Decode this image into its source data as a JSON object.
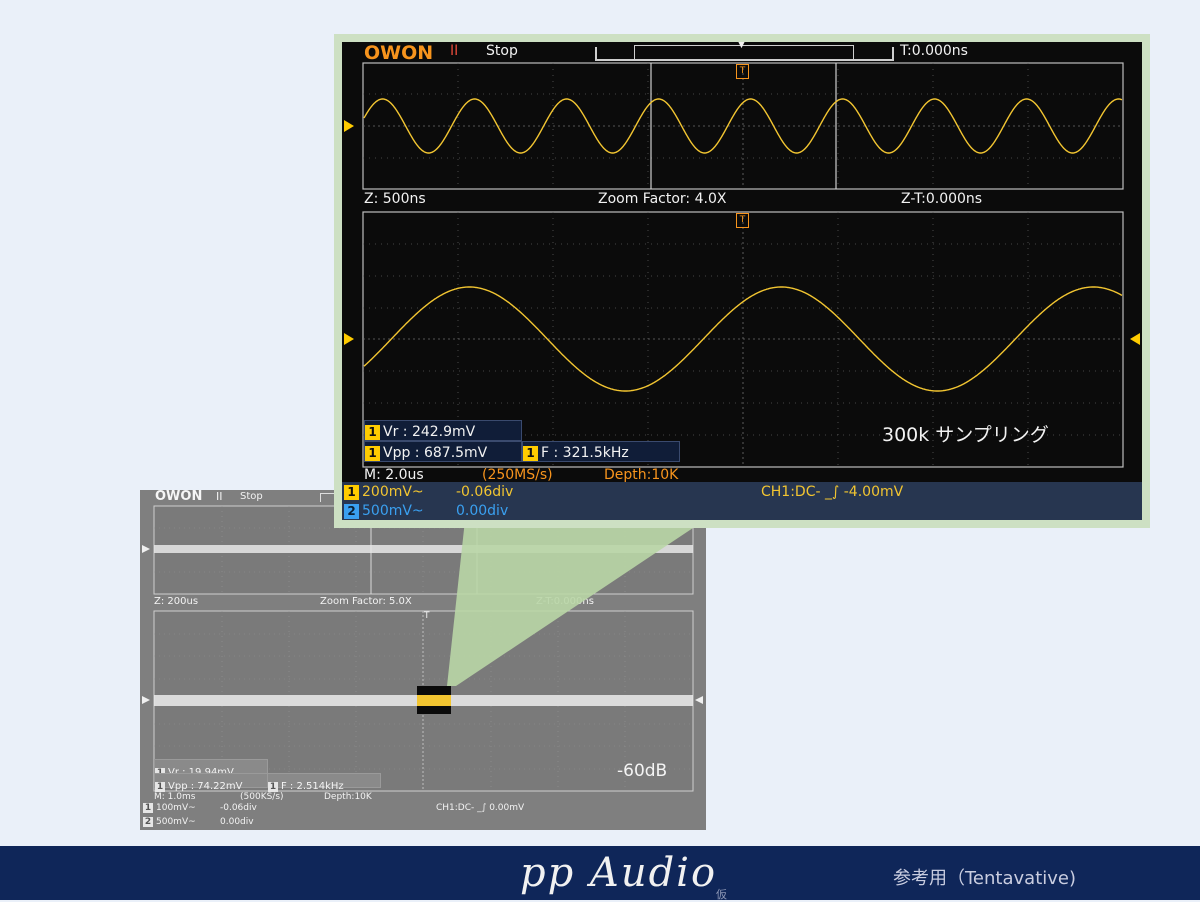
{
  "small_scope": {
    "brand": "OWON",
    "run_state_icon": "pause-icon",
    "run_state": "Stop",
    "zoom_time": "Z: 200us",
    "zoom_factor": "Zoom Factor: 5.0X",
    "zoom_trigger_time": "Z-T:0.000ns",
    "trigger_marker": "T",
    "measurements": {
      "vr": {
        "ch": "1",
        "text": "Vr : 19.94mV"
      },
      "vpp": {
        "ch": "1",
        "text": "Vpp : 74.22mV"
      },
      "freq": {
        "ch": "1",
        "text": "F : 2.514kHz"
      }
    },
    "overlay_label": "-60dB",
    "timebase": "M: 1.0ms",
    "sample_rate": "(500KS/s)",
    "depth": "Depth:10K",
    "ch1": {
      "num": "1",
      "scale": "100mV~",
      "offset": "-0.06div"
    },
    "ch2": {
      "num": "2",
      "scale": "500mV~",
      "offset": "0.00div"
    },
    "trigger": {
      "source": "CH1:DC-",
      "level": "0.00mV"
    }
  },
  "large_scope": {
    "brand": "OWON",
    "run_state_icon": "pause-icon",
    "run_state": "Stop",
    "trigger_time": "T:0.000ns",
    "zoom_time": "Z: 500ns",
    "zoom_factor": "Zoom Factor: 4.0X",
    "zoom_trigger_time": "Z-T:0.000ns",
    "trigger_marker": "T",
    "measurements": {
      "vr": {
        "ch": "1",
        "text": "Vr : 242.9mV"
      },
      "vpp": {
        "ch": "1",
        "text": "Vpp : 687.5mV"
      },
      "freq": {
        "ch": "1",
        "text": "F : 321.5kHz"
      }
    },
    "overlay_label": "300k サンプリング",
    "timebase": "M: 2.0us",
    "sample_rate": "(250MS/s)",
    "depth": "Depth:10K",
    "ch1": {
      "num": "1",
      "scale": "200mV~",
      "offset": "-0.06div"
    },
    "ch2": {
      "num": "2",
      "scale": "500mV~",
      "offset": "0.00div"
    },
    "trigger": {
      "source": "CH1:DC-",
      "level": "-4.00mV"
    }
  },
  "footer": {
    "brand": "pp Audio",
    "brand_mark": "仮",
    "note": "参考用（Tentavative)"
  },
  "colors": {
    "page_background": "#eaf0f9",
    "footer": "#0f2659",
    "trace_ch1": "#f2c531",
    "ch2": "#3aa0f0",
    "owon_logo": "#f7941d",
    "frame_highlight": "#cde0c3"
  }
}
